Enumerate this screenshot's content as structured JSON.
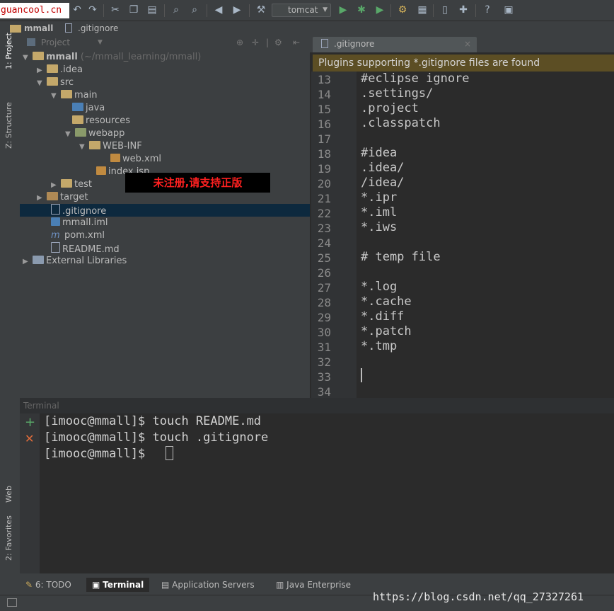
{
  "watermarks": {
    "top": "guancool.cn",
    "bottom": "https://blog.csdn.net/qq_27327261",
    "unregistered": "未注册,请支持正版"
  },
  "toolbar": {
    "run_config": "tomcat",
    "icons": [
      "undo-icon",
      "redo-icon",
      "cut-icon",
      "copy-icon",
      "paste-icon",
      "find-icon",
      "replace-icon",
      "back-icon",
      "forward-icon",
      "build-icon",
      "run-icon",
      "debug-icon",
      "coverage-icon",
      "settings-icon",
      "project-structure-icon",
      "sdk-icon",
      "plugin-icon",
      "help-icon",
      "terminal-icon"
    ]
  },
  "breadcrumb": {
    "project": "mmall",
    "file": ".gitignore"
  },
  "side_tabs": {
    "project": "1: Project",
    "structure": "Z: Structure",
    "web": "Web",
    "favorites": "2: Favorites"
  },
  "project_panel": {
    "header": "Project",
    "root_name": "mmall",
    "root_path": "(~/mmall_learning/mmall)",
    "items": [
      {
        "label": ".idea"
      },
      {
        "label": "src"
      },
      {
        "label": "main"
      },
      {
        "label": "java"
      },
      {
        "label": "resources"
      },
      {
        "label": "webapp"
      },
      {
        "label": "WEB-INF"
      },
      {
        "label": "web.xml"
      },
      {
        "label": "index.jsp"
      },
      {
        "label": "test"
      },
      {
        "label": "target"
      },
      {
        "label": ".gitignore"
      },
      {
        "label": "mmall.iml"
      },
      {
        "label": "pom.xml"
      },
      {
        "label": "README.md"
      },
      {
        "label": "External Libraries"
      }
    ]
  },
  "editor": {
    "tab": ".gitignore",
    "banner": "Plugins supporting *.gitignore files are found",
    "line_numbers": [
      "13",
      "14",
      "15",
      "16",
      "17",
      "18",
      "19",
      "20",
      "21",
      "22",
      "23",
      "24",
      "25",
      "26",
      "27",
      "28",
      "29",
      "30",
      "31",
      "32",
      "33",
      "34"
    ],
    "lines": [
      "#eclipse ignore",
      ".settings/",
      ".project",
      ".classpatch",
      "",
      "#idea",
      ".idea/",
      "/idea/",
      "*.ipr",
      "*.iml",
      "*.iws",
      "",
      "# temp file",
      "",
      "*.log",
      "*.cache",
      "*.diff",
      "*.patch",
      "*.tmp",
      "",
      "",
      ""
    ]
  },
  "terminal": {
    "title": "Terminal",
    "lines": [
      "[imooc@mmall]$ touch README.md",
      "[imooc@mmall]$ touch .gitignore",
      "[imooc@mmall]$ "
    ]
  },
  "bottom_tabs": {
    "todo": "6: TODO",
    "terminal": "Terminal",
    "app_servers": "Application Servers",
    "java_enterprise": "Java Enterprise"
  }
}
